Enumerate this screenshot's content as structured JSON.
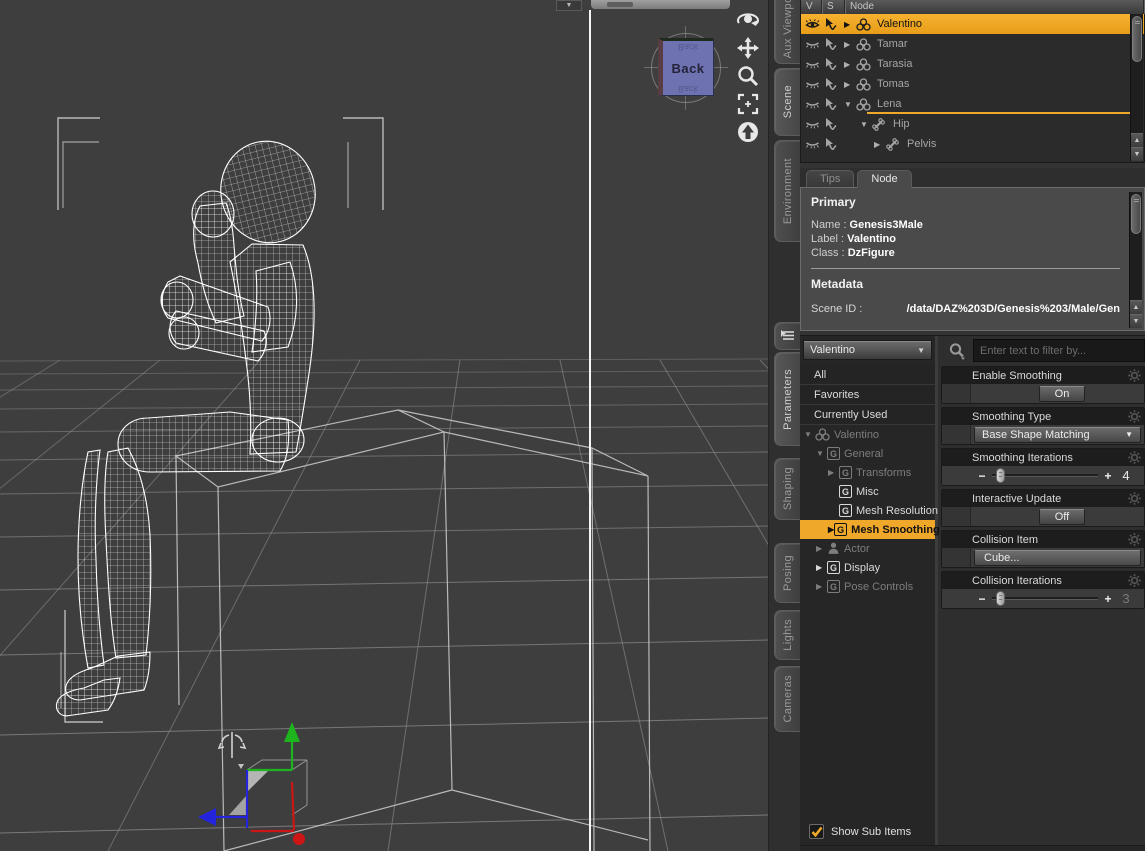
{
  "colors": {
    "accent": "#F0A82A",
    "viewport_bg": "#3E3E3E",
    "nav_cube_face": "#6E72B0"
  },
  "viewport": {
    "nav_cube_label": "Back",
    "tools": [
      {
        "icon": "orbit-icon"
      },
      {
        "icon": "pan-icon"
      },
      {
        "icon": "zoom-icon"
      },
      {
        "icon": "frame-icon"
      },
      {
        "icon": "aim-up-icon"
      }
    ]
  },
  "side_tabs": {
    "items": [
      {
        "label": "Aux Viewport"
      },
      {
        "label": "Scene"
      },
      {
        "label": "Environment"
      },
      {
        "label": "Parameters"
      },
      {
        "label": "Shaping"
      },
      {
        "label": "Posing"
      },
      {
        "label": "Lights"
      },
      {
        "label": "Cameras"
      }
    ]
  },
  "scene": {
    "columns": [
      {
        "label": "V"
      },
      {
        "label": "S"
      },
      {
        "label": "Node"
      }
    ],
    "rows": [
      {
        "label": "Valentino"
      },
      {
        "label": "Tamar"
      },
      {
        "label": "Tarasia"
      },
      {
        "label": "Tomas"
      },
      {
        "label": "Lena"
      },
      {
        "label": "Hip"
      },
      {
        "label": "Pelvis"
      }
    ]
  },
  "info": {
    "tabs": [
      {
        "label": "Tips"
      },
      {
        "label": "Node"
      }
    ],
    "primary_heading": "Primary",
    "fields": [
      {
        "label": "Name :",
        "value": "Genesis3Male"
      },
      {
        "label": "Label :",
        "value": "Valentino"
      },
      {
        "label": "Class :",
        "value": "DzFigure"
      }
    ],
    "metadata_heading": "Metadata",
    "scene_id_label": "Scene ID :",
    "scene_id_value": "/data/DAZ%203D/Genesis%203/Male/Gen"
  },
  "params": {
    "node_selector": "Valentino",
    "filter_placeholder": "Enter text to filter by...",
    "tree": [
      {
        "label": "All"
      },
      {
        "label": "Favorites"
      },
      {
        "label": "Currently Used"
      },
      {
        "label": "Valentino"
      },
      {
        "label": "General"
      },
      {
        "label": "Transforms"
      },
      {
        "label": "Misc"
      },
      {
        "label": "Mesh Resolution"
      },
      {
        "label": "Mesh Smoothing"
      },
      {
        "label": "Actor"
      },
      {
        "label": "Display"
      },
      {
        "label": "Pose Controls"
      }
    ],
    "slider_minus": "−",
    "slider_plus": "+",
    "groups": [
      {
        "label": "Enable Smoothing",
        "value": "On"
      },
      {
        "label": "Smoothing Type",
        "value": "Base Shape Matching"
      },
      {
        "label": "Smoothing Iterations",
        "value": "4"
      },
      {
        "label": "Interactive Update",
        "value": "Off"
      },
      {
        "label": "Collision Item",
        "value": "Cube..."
      },
      {
        "label": "Collision Iterations",
        "value": "3"
      }
    ],
    "show_sub_items": "Show Sub Items"
  }
}
